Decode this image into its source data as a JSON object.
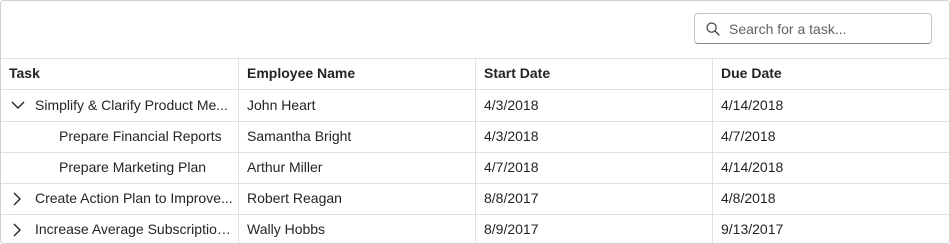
{
  "search": {
    "placeholder": "Search for a task..."
  },
  "columns": [
    "Task",
    "Employee Name",
    "Start Date",
    "Due Date"
  ],
  "rows": [
    {
      "task": "Simplify & Clarify Product Me...",
      "employee": "John Heart",
      "start": "4/3/2018",
      "due": "4/14/2018",
      "toggle": "collapse"
    },
    {
      "task": "Prepare Financial Reports",
      "employee": "Samantha Bright",
      "start": "4/3/2018",
      "due": "4/7/2018",
      "toggle": "none"
    },
    {
      "task": "Prepare Marketing Plan",
      "employee": "Arthur Miller",
      "start": "4/7/2018",
      "due": "4/14/2018",
      "toggle": "none"
    },
    {
      "task": "Create Action Plan to Improve...",
      "employee": "Robert Reagan",
      "start": "8/8/2017",
      "due": "4/8/2018",
      "toggle": "expand"
    },
    {
      "task": "Increase Average Subscription...",
      "employee": "Wally Hobbs",
      "start": "8/9/2017",
      "due": "9/13/2017",
      "toggle": "expand"
    }
  ]
}
